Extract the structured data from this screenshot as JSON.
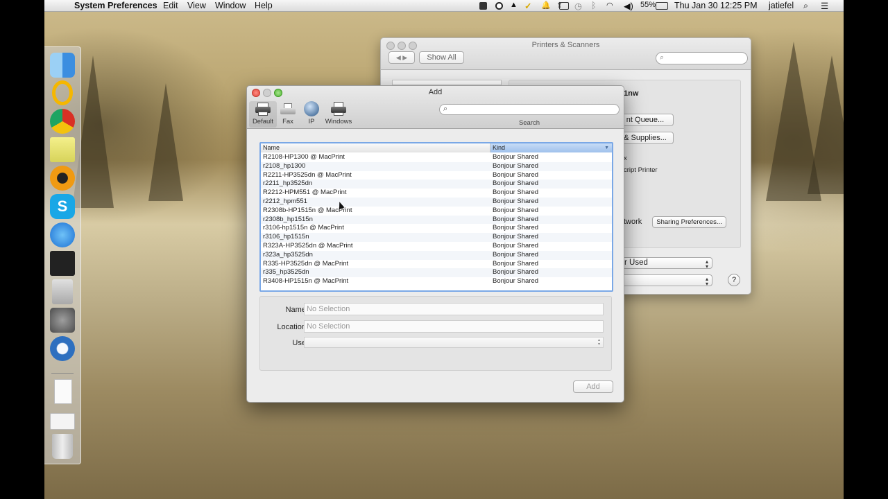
{
  "menubar": {
    "app_name": "System Preferences",
    "menus": [
      "Edit",
      "View",
      "Window",
      "Help"
    ],
    "battery": "55%",
    "datetime": "Thu Jan 30  12:25 PM",
    "user": "jatiefel"
  },
  "printers_window": {
    "title": "Printers & Scanners",
    "show_all": "Show All",
    "printer_name_partial": "1nw",
    "open_print_queue": "nt Queue...",
    "options_supplies": "& Supplies...",
    "kind_partial": "x",
    "type_partial": "cript Printer",
    "share_partial": "twork",
    "sharing_prefs": "Sharing Preferences...",
    "default_printer_partial": "r Used"
  },
  "add_dialog": {
    "title": "Add",
    "toolbar": [
      {
        "label": "Default",
        "icon": "default-printer-icon"
      },
      {
        "label": "Fax",
        "icon": "fax-icon"
      },
      {
        "label": "IP",
        "icon": "ip-globe-icon"
      },
      {
        "label": "Windows",
        "icon": "windows-printer-icon"
      }
    ],
    "search_label": "Search",
    "columns": [
      "Name",
      "Kind"
    ],
    "printers": [
      {
        "name": "R2108-HP1300 @ MacPrint",
        "kind": "Bonjour Shared"
      },
      {
        "name": "r2108_hp1300",
        "kind": "Bonjour Shared"
      },
      {
        "name": "R2211-HP3525dn @ MacPrint",
        "kind": "Bonjour Shared"
      },
      {
        "name": "r2211_hp3525dn",
        "kind": "Bonjour Shared"
      },
      {
        "name": "R2212-HPM551 @ MacPrint",
        "kind": "Bonjour Shared"
      },
      {
        "name": "r2212_hpm551",
        "kind": "Bonjour Shared"
      },
      {
        "name": "R2308b-HP1515n @ MacPrint",
        "kind": "Bonjour Shared"
      },
      {
        "name": "r2308b_hp1515n",
        "kind": "Bonjour Shared"
      },
      {
        "name": "r3106-hp1515n @ MacPrint",
        "kind": "Bonjour Shared"
      },
      {
        "name": "r3106_hp1515n",
        "kind": "Bonjour Shared"
      },
      {
        "name": "R323A-HP3525dn @ MacPrint",
        "kind": "Bonjour Shared"
      },
      {
        "name": "r323a_hp3525dn",
        "kind": "Bonjour Shared"
      },
      {
        "name": "R335-HP3525dn @ MacPrint",
        "kind": "Bonjour Shared"
      },
      {
        "name": "r335_hp3525dn",
        "kind": "Bonjour Shared"
      },
      {
        "name": "R3408-HP1515n @ MacPrint",
        "kind": "Bonjour Shared"
      }
    ],
    "form": {
      "name_label": "Name:",
      "name_value": "No Selection",
      "location_label": "Location:",
      "location_value": "No Selection",
      "use_label": "Use:",
      "use_value": ""
    },
    "add_button": "Add"
  },
  "dock_icons": [
    "finder-icon",
    "outlook-icon",
    "chrome-icon",
    "notes-icon",
    "app-icon",
    "skype-icon",
    "app-store-icon",
    "amazon-mp3-icon",
    "calculator-icon",
    "system-preferences-icon",
    "quicktime-icon",
    "document-icon",
    "chrome-window-icon",
    "trash-icon"
  ],
  "colors": {
    "selection_blue": "#7aa8e6",
    "kind_header": "#9fc1ec"
  }
}
